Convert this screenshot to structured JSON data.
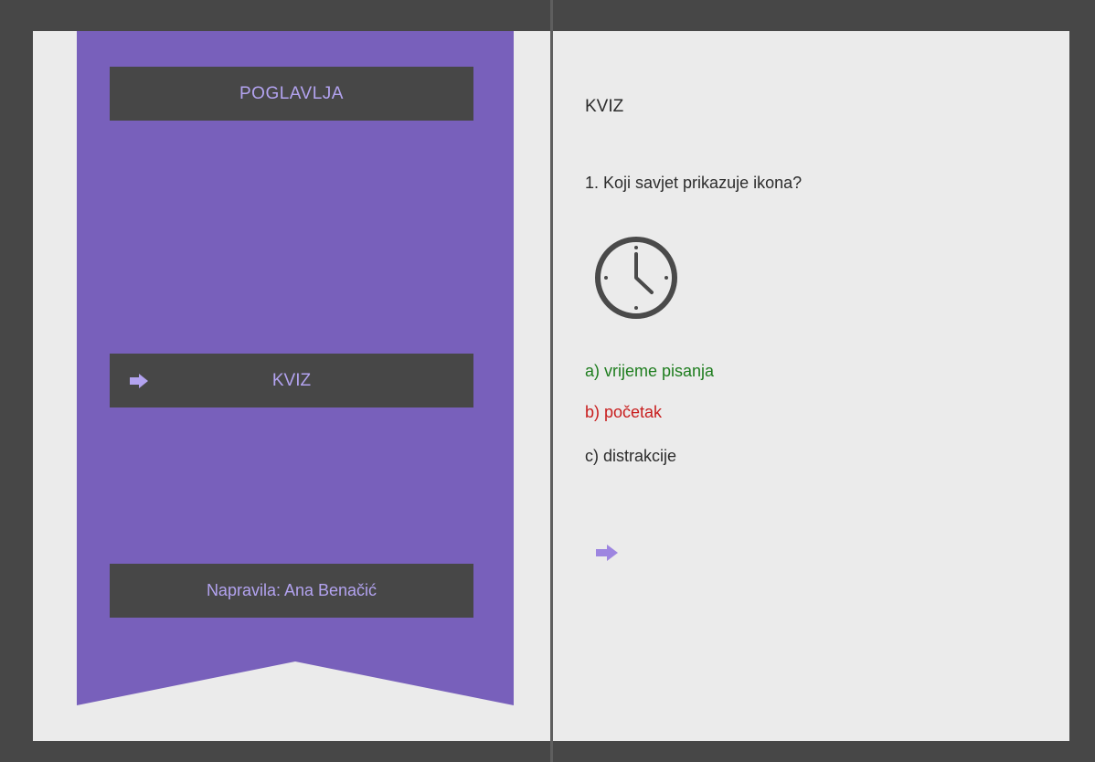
{
  "sidebar": {
    "chapters_label": "POGLAVLJA",
    "quiz_label": "KVIZ",
    "author_label": "Napravila: Ana Benačić"
  },
  "quiz": {
    "title": "KVIZ",
    "question": "1. Koji savjet prikazuje ikona?",
    "icon": "clock-icon",
    "answers": [
      {
        "text": "a) vrijeme pisanja",
        "status": "correct",
        "color": "#1e7d1e"
      },
      {
        "text": "b) početak",
        "status": "incorrect",
        "color": "#c81e1e"
      },
      {
        "text": "c) distrakcije",
        "status": "neutral",
        "color": "#2c2c2c"
      }
    ]
  },
  "colors": {
    "frame": "#474747",
    "page": "#ebebeb",
    "ribbon": "#7860bb",
    "accent": "#b3a3f0",
    "panel": "#474747"
  }
}
